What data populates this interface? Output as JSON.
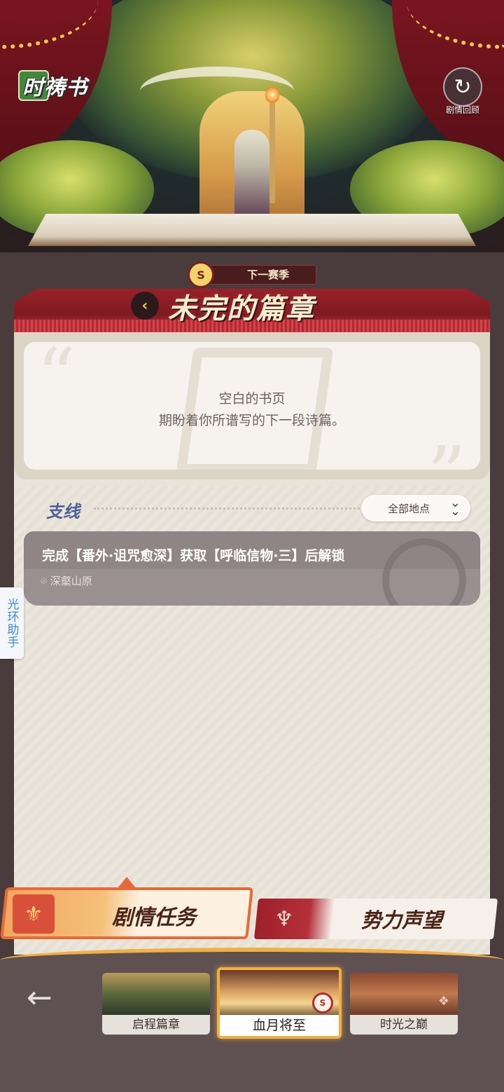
{
  "hero": {
    "title": "时祷书",
    "replay_label": "剧情回顾",
    "replay_icon": "replay-icon"
  },
  "chapter": {
    "season_badge": "S",
    "season_label": "下一赛季",
    "title": "未完的篇章",
    "back_icon": "chevron-left-icon"
  },
  "intro": {
    "line1": "空白的书页",
    "line2": "期盼着你所谱写的下一段诗篇。"
  },
  "branch": {
    "title": "支线",
    "filter_label": "全部地点",
    "filter_icon": "double-chevron-down-icon",
    "quests": [
      {
        "text": "完成【番外·诅咒愈深】获取【呼临信物·三】后解锁",
        "location": "深壑山原",
        "location_icon": "map-pin-icon",
        "locked": true
      }
    ]
  },
  "side_helper": {
    "label": "光环助手"
  },
  "tabs": {
    "story": {
      "label": "剧情任务",
      "active": true
    },
    "reputation": {
      "label": "势力声望",
      "active": false
    }
  },
  "seasons": {
    "back_icon": "arrow-left-icon",
    "items": [
      {
        "label": "启程篇章",
        "selected": false
      },
      {
        "label": "血月将至",
        "selected": true,
        "badge": "S"
      },
      {
        "label": "时光之巅",
        "selected": false
      }
    ]
  },
  "colors": {
    "accent_orange": "#e86a35",
    "banner_red": "#9a2028",
    "section_blue": "#4e5f98",
    "gold": "#f2b040"
  }
}
